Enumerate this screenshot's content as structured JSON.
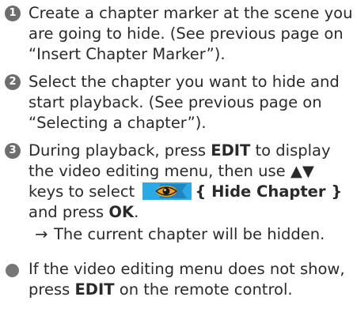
{
  "steps": [
    {
      "number": "1",
      "text": "Create a chapter marker at the scene you are going to hide. (See previous page on “Insert Chapter Marker”)."
    },
    {
      "number": "2",
      "text": "Select the chapter you want to hide and start playback. (See previous page on “Selecting a chapter”)."
    },
    {
      "number": "3",
      "part1": "During playback, press ",
      "edit_key": "EDIT",
      "part2": " to display the video editing menu, then use ",
      "arrows": "▲▼",
      "part3": " keys to select ",
      "option": "{ Hide Chapter }",
      "part4": " and press ",
      "ok_key": "OK",
      "part5": ".",
      "arrow_symbol": "→",
      "result": "The current chapter will be hidden."
    }
  ],
  "note": {
    "part1": "If the video editing menu does not show, press ",
    "edit_key": "EDIT",
    "part2": " on the remote control."
  },
  "icon": {
    "name": "hide-chapter-eye-icon",
    "colors": {
      "background": "#2aa9e6",
      "eye": "#f2a21a"
    }
  }
}
